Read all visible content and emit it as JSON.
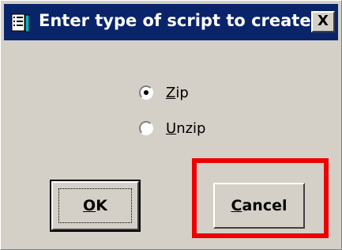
{
  "dialog": {
    "title": "Enter type of script to create",
    "close_label": "X",
    "options": [
      {
        "label": "Zip",
        "checked": true
      },
      {
        "label": "Unzip",
        "checked": false
      }
    ],
    "ok_label": "OK",
    "cancel_label": "Cancel"
  },
  "icons": {
    "title_icon": "script-app-icon",
    "close_icon": "close-icon"
  },
  "colors": {
    "titlebar": "#0a246a",
    "dialog_bg": "#d4d0c8",
    "highlight": "#ee0000"
  }
}
